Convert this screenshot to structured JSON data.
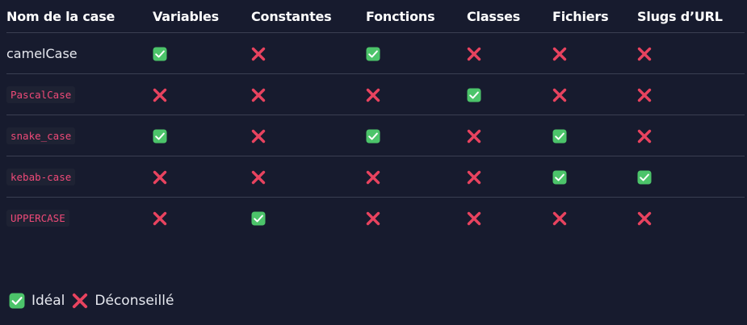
{
  "headers": [
    "Nom de la case",
    "Variables",
    "Constantes",
    "Fonctions",
    "Classes",
    "Fichiers",
    "Slugs d’URL"
  ],
  "rows": [
    {
      "name": "camelCase",
      "code": false,
      "values": [
        "check",
        "cross",
        "check",
        "cross",
        "cross",
        "cross"
      ]
    },
    {
      "name": "PascalCase",
      "code": true,
      "values": [
        "cross",
        "cross",
        "cross",
        "check",
        "cross",
        "cross"
      ]
    },
    {
      "name": "snake_case",
      "code": true,
      "values": [
        "check",
        "cross",
        "check",
        "cross",
        "check",
        "cross"
      ]
    },
    {
      "name": "kebab-case",
      "code": true,
      "values": [
        "cross",
        "cross",
        "cross",
        "cross",
        "check",
        "check"
      ]
    },
    {
      "name": "UPPERCASE",
      "code": true,
      "values": [
        "cross",
        "check",
        "cross",
        "cross",
        "cross",
        "cross"
      ]
    }
  ],
  "legend": {
    "ideal_label": "Idéal",
    "discouraged_label": "Déconseillé"
  },
  "colors": {
    "background": "#171b2e",
    "check": "#4cc46a",
    "cross": "#e8435f",
    "code_text": "#ef4a78"
  },
  "icons": {
    "check": "check-icon",
    "cross": "cross-icon"
  }
}
